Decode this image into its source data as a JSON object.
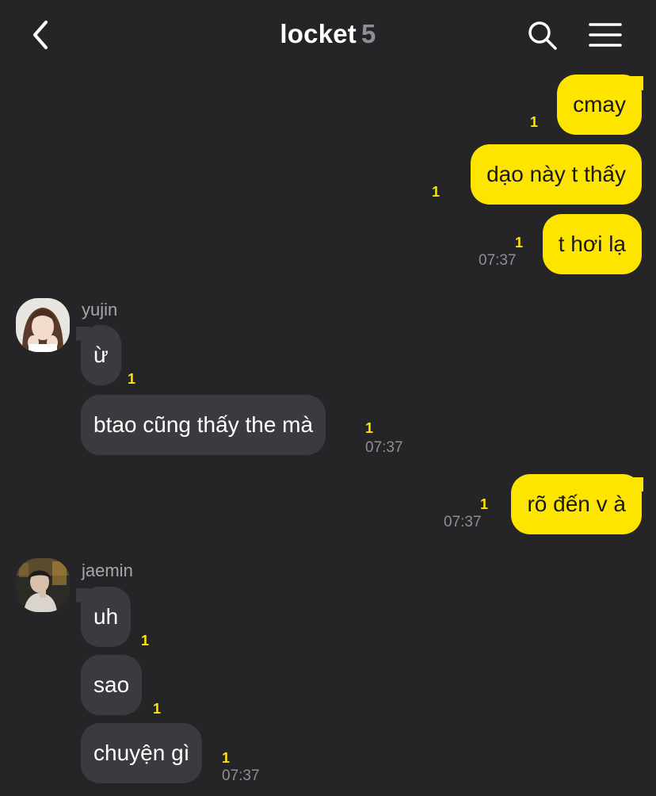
{
  "header": {
    "title": "locket",
    "member_count": "5",
    "back_icon": "chevron-left-icon",
    "search_icon": "search-icon",
    "menu_icon": "hamburger-menu-icon"
  },
  "colors": {
    "background": "#252528",
    "my_bubble": "#fee500",
    "their_bubble": "#3b3b3f",
    "unread": "#fee500",
    "timestamp": "#8e8e93"
  },
  "messages": [
    {
      "from": "me",
      "text": "cmay",
      "unread": "1"
    },
    {
      "from": "me",
      "text": "dạo này t thấy",
      "unread": "1"
    },
    {
      "from": "me",
      "text": "t hơi lạ",
      "unread": "1",
      "time": "07:37"
    },
    {
      "from": "yujin",
      "sender": "yujin",
      "text": "ừ",
      "unread": "1"
    },
    {
      "from": "yujin",
      "text": "btao cũng thấy the mà",
      "unread": "1",
      "time": "07:37"
    },
    {
      "from": "me",
      "text": "rõ đến v à",
      "unread": "1",
      "time": "07:37"
    },
    {
      "from": "jaemin",
      "sender": "jaemin",
      "text": "uh",
      "unread": "1"
    },
    {
      "from": "jaemin",
      "text": "sao",
      "unread": "1"
    },
    {
      "from": "jaemin",
      "text": "chuyện gì",
      "unread": "1",
      "time": "07:37"
    }
  ]
}
